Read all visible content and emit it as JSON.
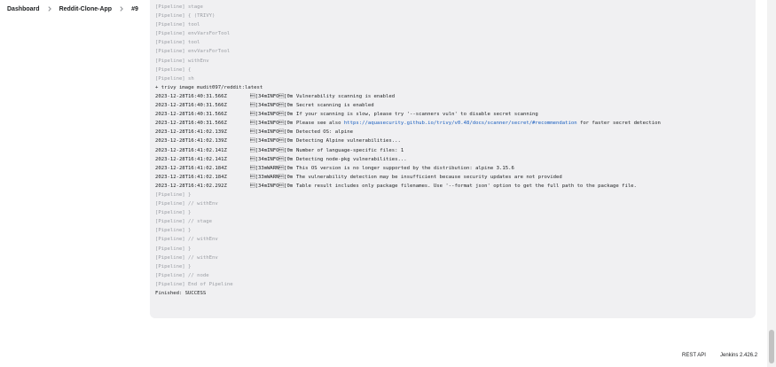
{
  "breadcrumb": [
    "Dashboard",
    "Reddit-Clone-App",
    "#9"
  ],
  "console": {
    "prelines": [
      "[Pipeline] stage",
      "[Pipeline] { (TRIVY)",
      "[Pipeline] tool",
      "[Pipeline] envVarsForTool",
      "[Pipeline] tool",
      "[Pipeline] envVarsForTool",
      "[Pipeline] withEnv",
      "[Pipeline] {",
      "[Pipeline] sh"
    ],
    "command": "+ trivy image mudit097/reddit:latest",
    "logs": [
      {
        "ts": "2023-12-28T16:40:31.566Z",
        "level": "\u001b[34mINFO\u001b[0m",
        "msg": "Vulnerability scanning is enabled"
      },
      {
        "ts": "2023-12-28T16:40:31.566Z",
        "level": "\u001b[34mINFO\u001b[0m",
        "msg": "Secret scanning is enabled"
      },
      {
        "ts": "2023-12-28T16:40:31.566Z",
        "level": "\u001b[34mINFO\u001b[0m",
        "msg": "If your scanning is slow, please try '--scanners vuln' to disable secret scanning"
      },
      {
        "ts": "2023-12-28T16:40:31.566Z",
        "level": "\u001b[34mINFO\u001b[0m",
        "msg": "Please see also ",
        "link": "https://aquasecurity.github.io/trivy/v0.48/docs/scanner/secret/#recommendation",
        "after": " for faster secret detection"
      },
      {
        "ts": "2023-12-28T16:41:02.139Z",
        "level": "\u001b[34mINFO\u001b[0m",
        "msg": "Detected OS: alpine"
      },
      {
        "ts": "2023-12-28T16:41:02.139Z",
        "level": "\u001b[34mINFO\u001b[0m",
        "msg": "Detecting Alpine vulnerabilities..."
      },
      {
        "ts": "2023-12-28T16:41:02.141Z",
        "level": "\u001b[34mINFO\u001b[0m",
        "msg": "Number of language-specific files: 1"
      },
      {
        "ts": "2023-12-28T16:41:02.141Z",
        "level": "\u001b[34mINFO\u001b[0m",
        "msg": "Detecting node-pkg vulnerabilities..."
      },
      {
        "ts": "2023-12-28T16:41:02.184Z",
        "level": "\u001b[33mWARN\u001b[0m",
        "msg": "This OS version is no longer supported by the distribution: alpine 3.15.6"
      },
      {
        "ts": "2023-12-28T16:41:02.184Z",
        "level": "\u001b[33mWARN\u001b[0m",
        "msg": "The vulnerability detection may be insufficient because security updates are not provided"
      },
      {
        "ts": "2023-12-28T16:41:02.292Z",
        "level": "\u001b[34mINFO\u001b[0m",
        "msg": "Table result includes only package filenames. Use '--format json' option to get the full path to the package file."
      }
    ],
    "postlines": [
      "[Pipeline] }",
      "[Pipeline] // withEnv",
      "[Pipeline] }",
      "[Pipeline] // stage",
      "[Pipeline] }",
      "[Pipeline] // withEnv",
      "[Pipeline] }",
      "[Pipeline] // withEnv",
      "[Pipeline] }",
      "[Pipeline] // node",
      "[Pipeline] End of Pipeline"
    ],
    "finished": "Finished: SUCCESS"
  },
  "footer": {
    "rest_api": "REST API",
    "version": "Jenkins 2.426.2"
  },
  "colors": {
    "console_bg": "#f0f0f2",
    "muted_text": "#9a9da3",
    "link": "#1a5fc0"
  }
}
